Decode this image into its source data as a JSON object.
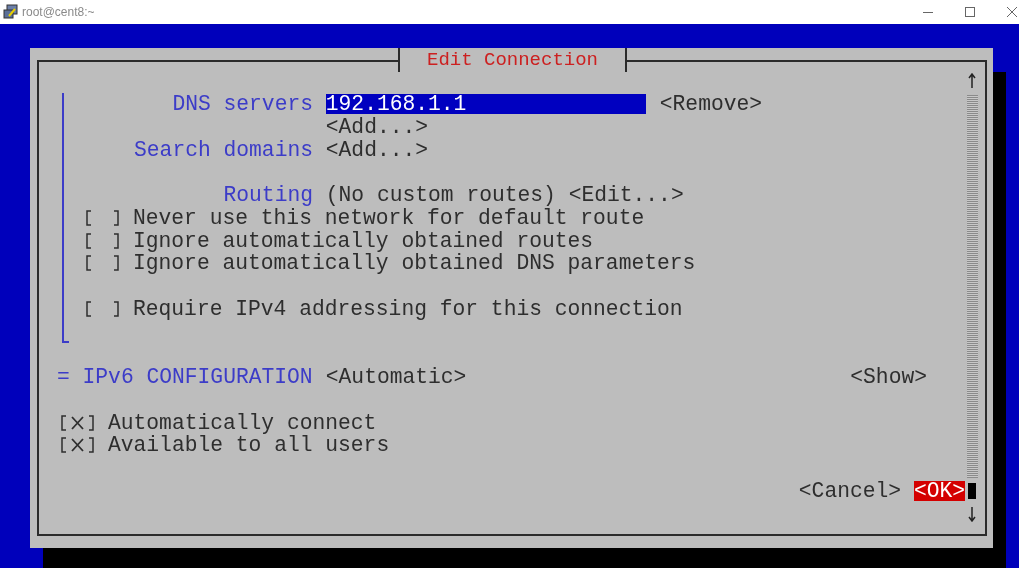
{
  "window": {
    "title": "root@cent8:~"
  },
  "dialog": {
    "title": "Edit Connection"
  },
  "ipv4": {
    "dns_servers": {
      "label": "DNS servers",
      "value": "192.168.1.1",
      "focused": true,
      "remove": "<Remove>",
      "add": "<Add...>"
    },
    "search_domains": {
      "label": "Search domains",
      "add": "<Add...>"
    },
    "routing": {
      "label": "Routing",
      "value": "(No custom routes)",
      "edit": "<Edit...>"
    },
    "options": [
      {
        "label": "Never use this network for default route",
        "checked": false
      },
      {
        "label": "Ignore automatically obtained routes",
        "checked": false
      },
      {
        "label": "Ignore automatically obtained DNS parameters",
        "checked": false
      }
    ],
    "require": {
      "label": "Require IPv4 addressing for this connection",
      "checked": false
    }
  },
  "ipv6": {
    "label": "= IPv6 CONFIGURATION",
    "mode": "<Automatic>",
    "show": "<Show>"
  },
  "general": [
    {
      "label": "Automatically connect",
      "checked": true
    },
    {
      "label": "Available to all users",
      "checked": true
    }
  ],
  "buttons": [
    {
      "label": "<Cancel>",
      "selected": false
    },
    {
      "label": "<OK>",
      "selected": true
    }
  ]
}
